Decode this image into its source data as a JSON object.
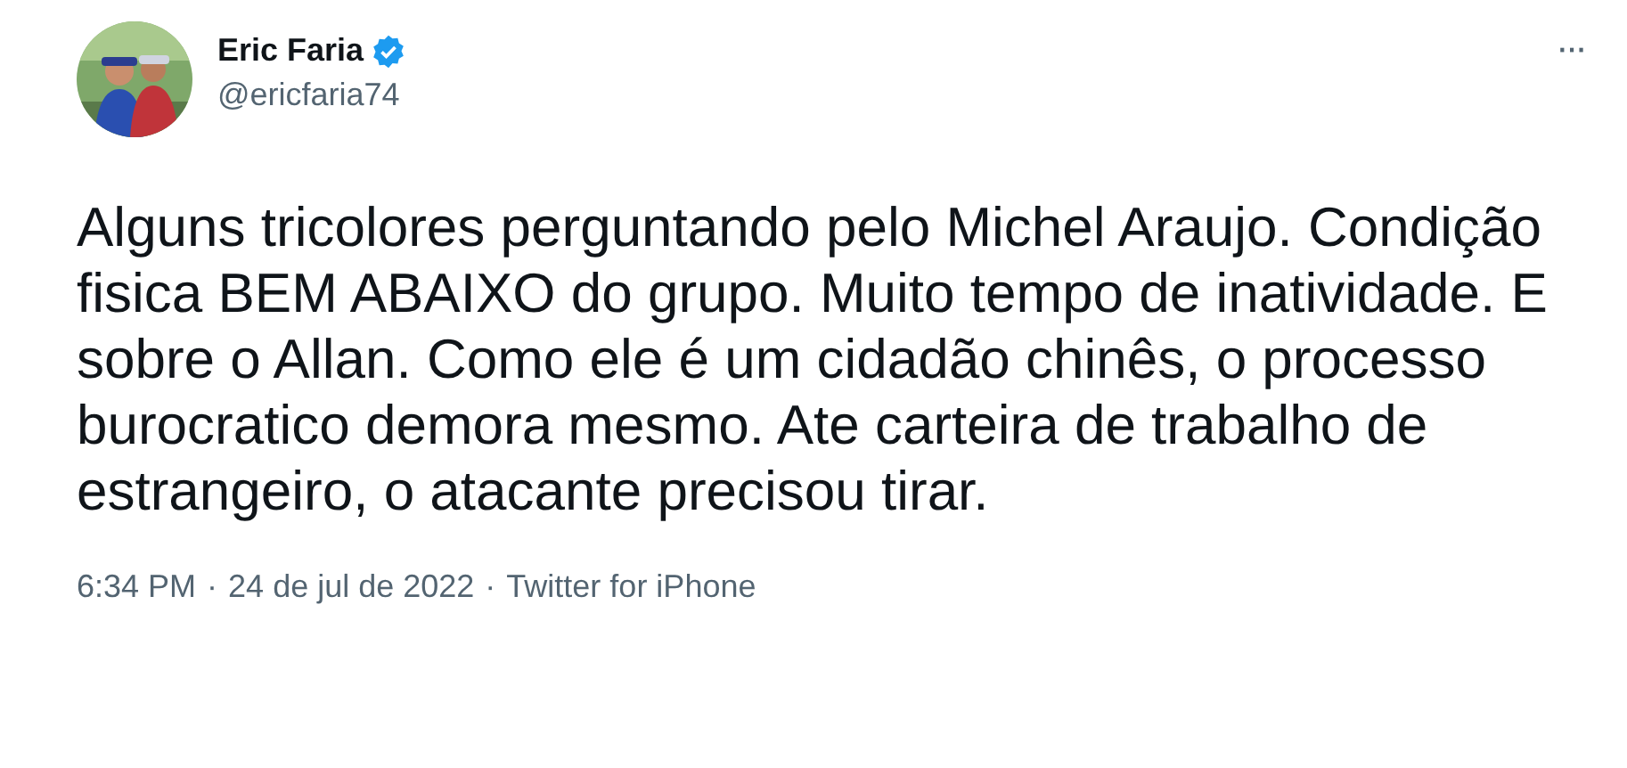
{
  "author": {
    "name": "Eric Faria",
    "verified": true,
    "handle": "@ericfaria74"
  },
  "more": "···",
  "text": "Alguns tricolores perguntando pelo Michel Araujo. Condição fisica BEM ABAIXO do grupo. Muito tempo de inatividade. E sobre o Allan. Como ele é um cidadão chinês, o processo burocratico demora mesmo. Ate carteira de trabalho de estrangeiro, o atacante precisou tirar.",
  "meta": {
    "time": "6:34 PM",
    "separator_1": "·",
    "date": "24 de jul de 2022",
    "separator_2": "·",
    "source": "Twitter for iPhone"
  }
}
